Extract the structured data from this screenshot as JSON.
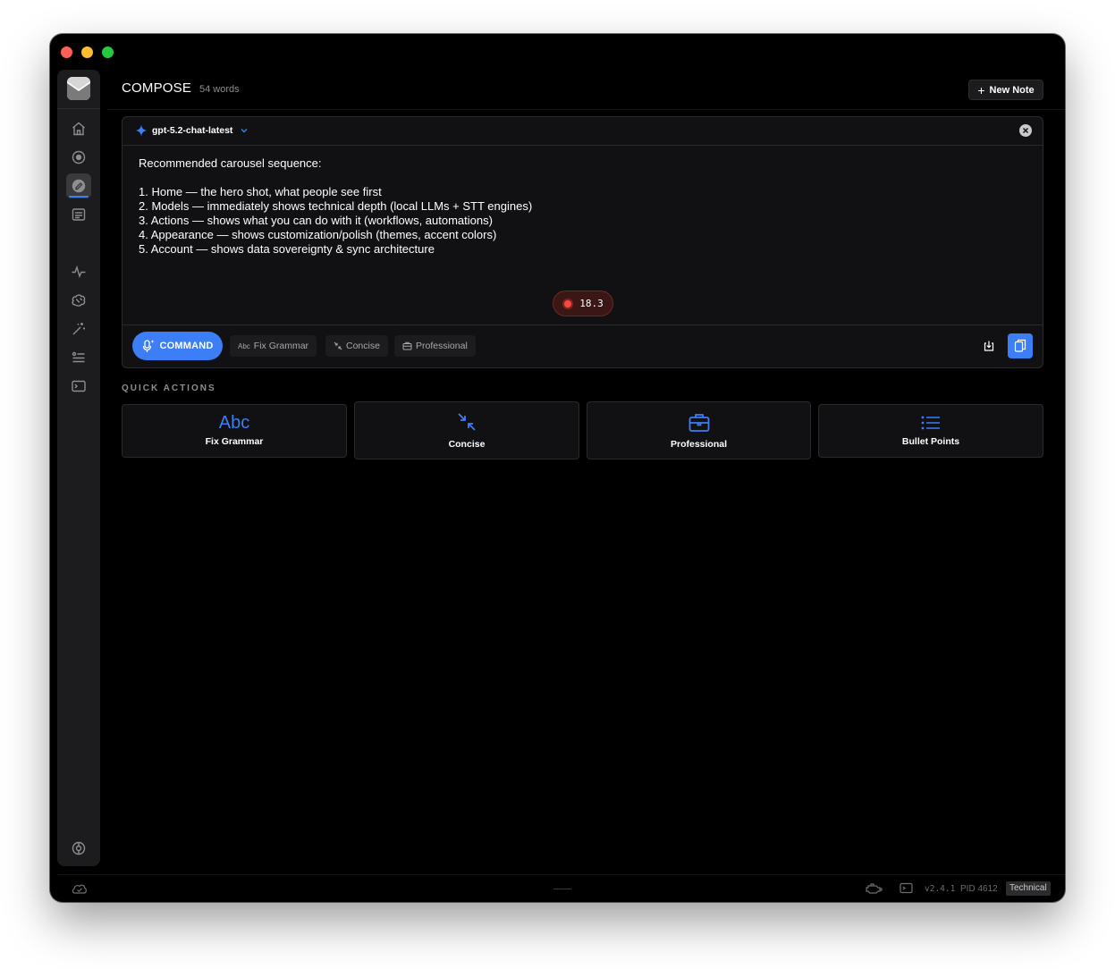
{
  "header": {
    "title": "COMPOSE",
    "word_count": "54 words",
    "new_note_label": "New Note"
  },
  "editor": {
    "model": "gpt-5.2-chat-latest",
    "lines": [
      "Recommended carousel sequence:",
      "1. Home — the hero shot, what people see first",
      "2. Models — immediately shows technical depth (local LLMs + STT engines)",
      "3. Actions — shows what you can do with it (workflows, automations)",
      "4. Appearance — shows customization/polish (themes, accent colors)",
      "5. Account — shows data sovereignty & sync architecture"
    ],
    "recording_value": "18.3"
  },
  "toolbar": {
    "command_label": "COMMAND",
    "chips": [
      {
        "icon_text": "Abc",
        "label": "Fix Grammar"
      },
      {
        "label": "Concise"
      },
      {
        "label": "Professional"
      }
    ]
  },
  "quick_actions": {
    "label": "QUICK ACTIONS",
    "items": [
      {
        "icon_text": "Abc",
        "label": "Fix Grammar"
      },
      {
        "label": "Concise"
      },
      {
        "label": "Professional"
      },
      {
        "label": "Bullet Points"
      }
    ]
  },
  "footer": {
    "version": "v2.4.1",
    "pid": "PID 4612",
    "mode": "Technical"
  },
  "colors": {
    "accent": "#3b7ef6",
    "record": "#ff453a",
    "background": "#000000",
    "panel": "#111113"
  },
  "icons": [
    "home-icon",
    "record-icon",
    "compose-icon",
    "notes-icon",
    "activity-icon",
    "brain-icon",
    "magic-wand-icon",
    "list-settings-icon",
    "terminal-icon",
    "settings-icon",
    "cloud-check-icon"
  ]
}
